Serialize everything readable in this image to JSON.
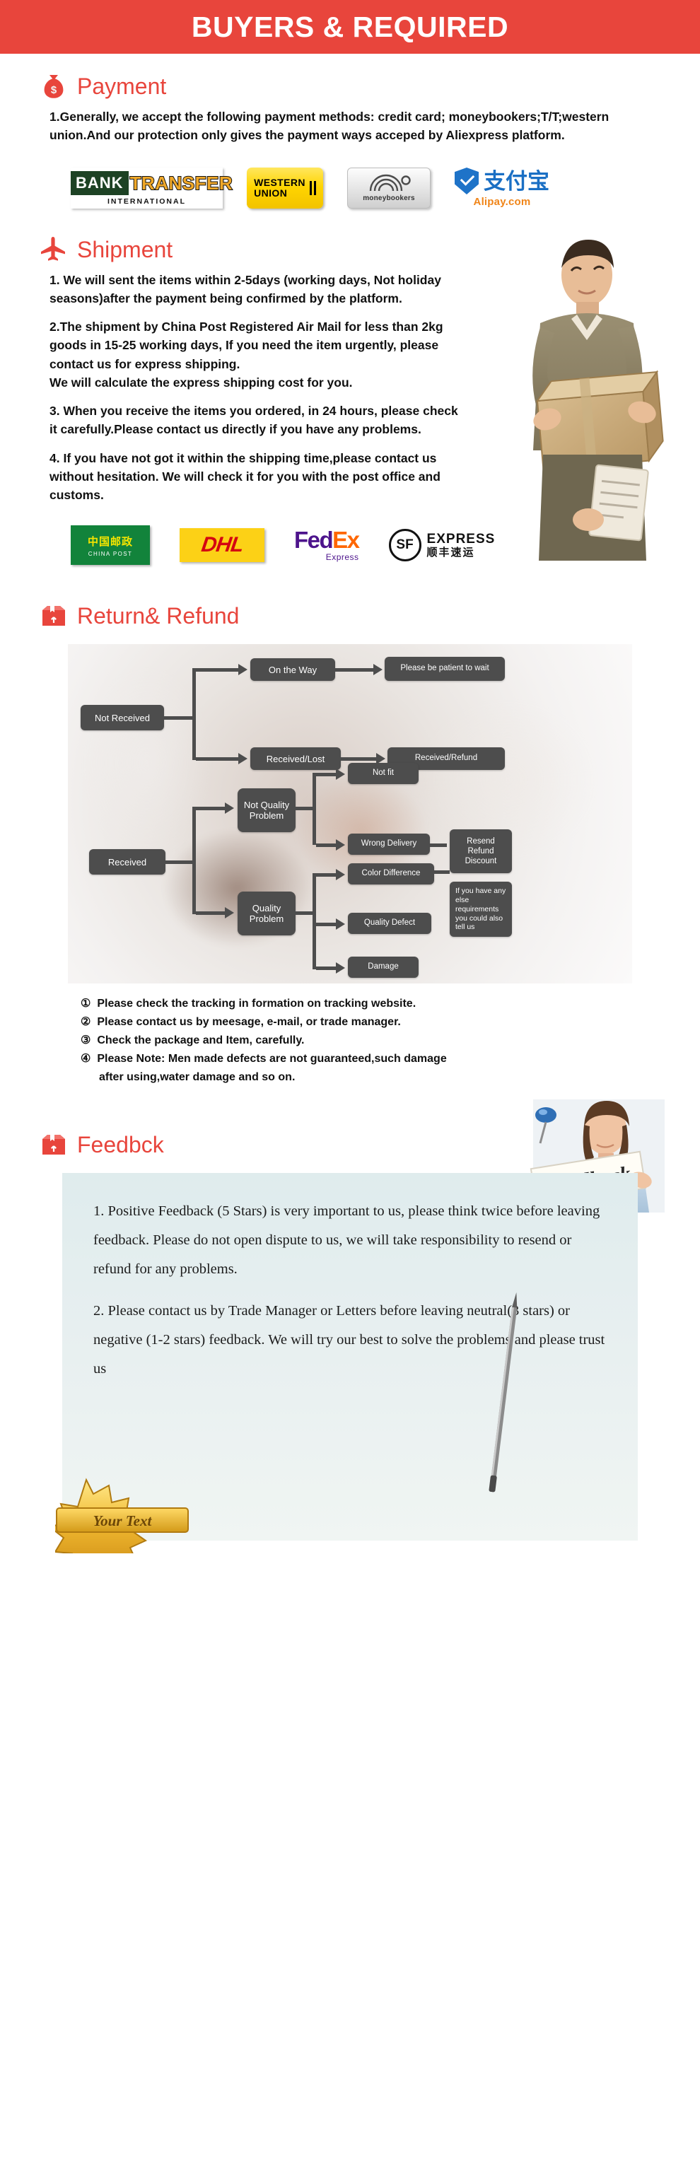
{
  "header": {
    "title": "BUYERS & REQUIRED"
  },
  "payment": {
    "icon": "money-bag-icon",
    "title": "Payment",
    "paragraphs": [
      "1.Generally, we accept the following payment methods: credit card; moneybookers;T/T;western union.And our protection only gives the payment ways acceped by Aliexpress platform."
    ],
    "logos": [
      {
        "name": "bank-transfer-logo",
        "line1a": "BANK",
        "line1b": "TRANSFER",
        "line2": "INTERNATIONAL"
      },
      {
        "name": "western-union-logo",
        "line1": "WESTERN",
        "line2": "UNION"
      },
      {
        "name": "moneybookers-logo",
        "text": "moneybookers"
      },
      {
        "name": "alipay-logo",
        "cn": "支付宝",
        "en": "Alipay.com"
      }
    ]
  },
  "shipment": {
    "icon": "airplane-icon",
    "title": "Shipment",
    "paragraphs": [
      "1. We will sent the items within 2-5days (working days, Not holiday seasons)after the payment being confirmed by the platform.",
      "2.The shipment by China Post Registered Air Mail for less than  2kg goods in 15-25 working days, If  you need the item urgently, please contact us for express shipping.",
      "We will calculate the express shipping cost for you.",
      "3. When you receive the items you ordered, in 24 hours, please check it carefully.Please contact us directly if you have any problems.",
      "4. If you have not got it within the shipping time,please contact us without hesitation. We will check it for you with the post office and customs."
    ],
    "carriers": [
      {
        "name": "china-post-logo",
        "cn": "中国邮政",
        "en": "CHINA POST"
      },
      {
        "name": "dhl-logo",
        "text": "DHL"
      },
      {
        "name": "fedex-logo",
        "fed": "Fed",
        "ex": "Ex",
        "sub": "Express"
      },
      {
        "name": "sf-express-logo",
        "badge": "SF",
        "line1": "EXPRESS",
        "line2": "顺丰速运"
      }
    ]
  },
  "return_refund": {
    "icon": "box-icon",
    "title": "Return& Refund",
    "flow": {
      "nodes": [
        {
          "id": "not-received",
          "label": "Not Received"
        },
        {
          "id": "on-the-way",
          "label": "On the Way"
        },
        {
          "id": "received-lost",
          "label": "Received/Lost"
        },
        {
          "id": "please-be-patient",
          "label": "Please be patient to wait"
        },
        {
          "id": "received-refund",
          "label": "Received/Refund"
        },
        {
          "id": "received",
          "label": "Received"
        },
        {
          "id": "not-quality-problem",
          "label": "Not Quality Problem"
        },
        {
          "id": "quality-problem",
          "label": "Quality Problem"
        },
        {
          "id": "not-fit",
          "label": "Not fit"
        },
        {
          "id": "wrong-delivery",
          "label": "Wrong Delivery"
        },
        {
          "id": "color-difference",
          "label": "Color Difference"
        },
        {
          "id": "quality-defect",
          "label": "Quality Defect"
        },
        {
          "id": "damage",
          "label": "Damage"
        },
        {
          "id": "resend-refund-discount",
          "label": "Resend Refund Discount"
        },
        {
          "id": "tell-us",
          "label": "If you have any else requirements you could also tell us"
        }
      ]
    },
    "notes": [
      {
        "marker": "①",
        "text": "Please check the tracking in formation on tracking website."
      },
      {
        "marker": "②",
        "text": "Please contact us by meesage, e-mail, or trade manager."
      },
      {
        "marker": "③",
        "text": "Check the package and Item, carefully."
      },
      {
        "marker": "④",
        "text": "Please Note: Men made defects  are not guaranteed,such damage",
        "sub": "after using,water damage and so on."
      }
    ]
  },
  "feedback": {
    "icon": "box-icon",
    "title": "Feedbck",
    "sign_text": "Feedback",
    "paragraphs": [
      "1. Positive Feedback (5 Stars) is very important to us, please think twice before leaving feedback. Please do not open dispute to us,   we will take responsibility to resend or refund for any problems.",
      "2. Please contact us by Trade Manager or Letters before leaving neutral(3 stars) or negative (1-2 stars) feedback. We will try our best to solve the problems and please trust us"
    ],
    "ribbon_text": "Your Text"
  },
  "colors": {
    "brand_red": "#e8453c",
    "node_gray": "#4d4d4d",
    "feedback_card": "#dfeced"
  }
}
